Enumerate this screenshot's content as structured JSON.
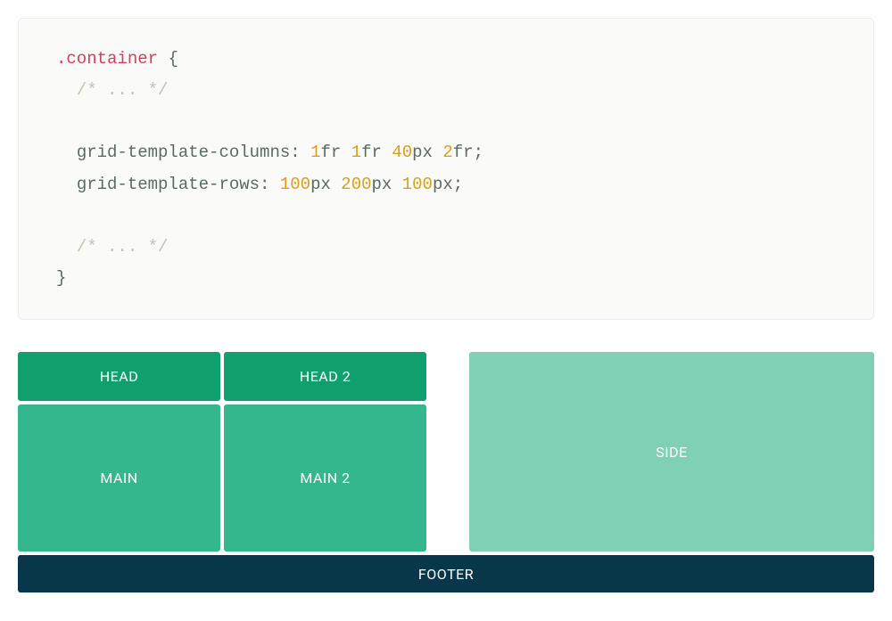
{
  "code": {
    "selector": ".container",
    "brace_open": "{",
    "comment1": "/* ... */",
    "prop1_name": "grid-template-columns",
    "prop1_v1": "1",
    "prop1_u1": "fr",
    "prop1_v2": "1",
    "prop1_u2": "fr",
    "prop1_v3": "40",
    "prop1_u3": "px",
    "prop1_v4": "2",
    "prop1_u4": "fr",
    "prop2_name": "grid-template-rows",
    "prop2_v1": "100",
    "prop2_u1": "px",
    "prop2_v2": "200",
    "prop2_u2": "px",
    "prop2_v3": "100",
    "prop2_u3": "px",
    "comment2": "/* ... */",
    "brace_close": "}"
  },
  "grid": {
    "head": "HEAD",
    "head2": "HEAD 2",
    "main": "MAIN",
    "main2": "MAIN 2",
    "side": "SIDE",
    "footer": "FOOTER"
  }
}
